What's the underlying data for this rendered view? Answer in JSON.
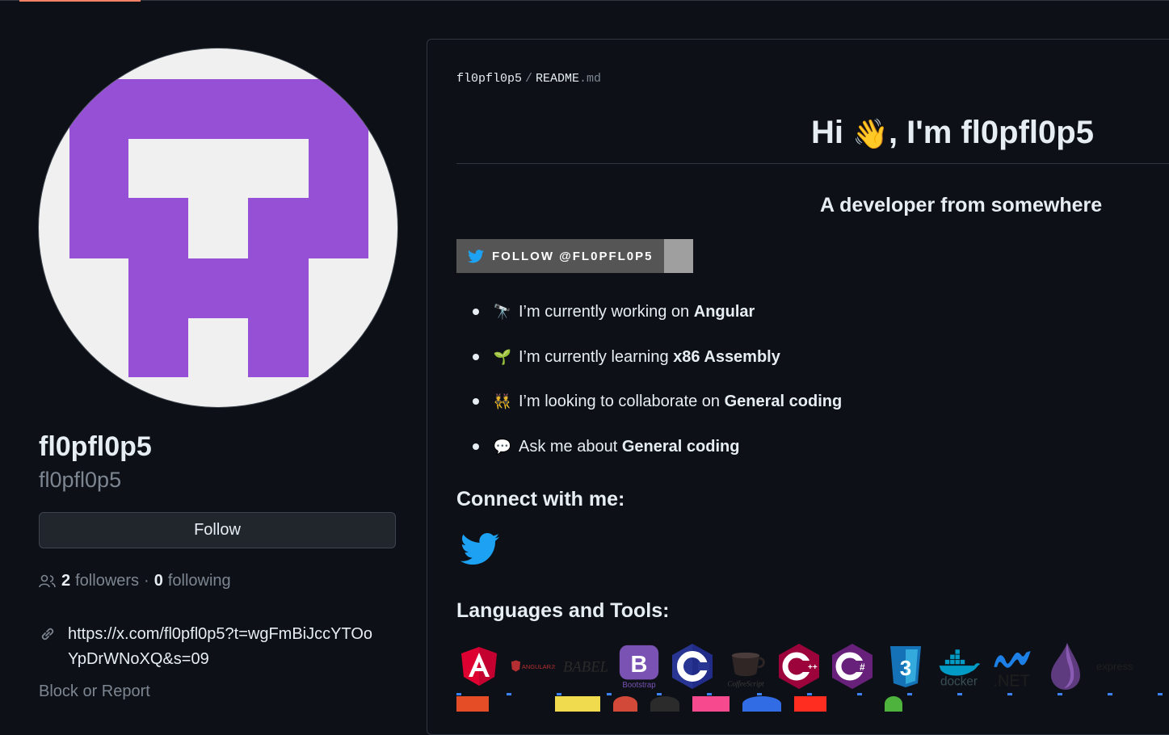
{
  "profile": {
    "display_name": "fl0pfl0p5",
    "login": "fl0pfl0p5",
    "follow_label": "Follow",
    "followers_count": "2",
    "followers_label": "followers",
    "separator": "·",
    "following_count": "0",
    "following_label": "following",
    "website": "https://x.com/fl0pfl0p5?t=wgFmBiJccYTOoYpDrWNoXQ&s=09",
    "block_label": "Block or Report",
    "avatar_color": "#9650d6"
  },
  "readme": {
    "path_user": "fl0pfl0p5",
    "path_sep": "/",
    "path_file": "README",
    "path_ext": ".md",
    "greeting_prefix": "Hi ",
    "greeting_emoji": "👋",
    "greeting_suffix": ", I'm fl0pfl0p5",
    "subtitle": "A developer from somewhere",
    "twitter_badge": "FOLLOW @FL0PFL0P5",
    "bullets": [
      {
        "emoji": "🔭",
        "text": "I’m currently working on ",
        "bold": "Angular"
      },
      {
        "emoji": "🌱",
        "text": "I’m currently learning ",
        "bold": "x86 Assembly"
      },
      {
        "emoji": "👯",
        "text": "I’m looking to collaborate on ",
        "bold": "General coding"
      },
      {
        "emoji": "💬",
        "text": "Ask me about ",
        "bold": "General coding"
      }
    ],
    "connect_heading": "Connect with me:",
    "languages_heading": "Languages and Tools:",
    "tools": [
      "angular-icon",
      "angularjs-icon",
      "babel-icon",
      "bootstrap-icon",
      "c-icon",
      "coffeescript-icon",
      "cplusplus-icon",
      "csharp-icon",
      "css3-icon",
      "docker-icon",
      "dotnet-icon",
      "elixir-icon",
      "express-icon"
    ],
    "tool_labels": {
      "angularjs": "ANGULARJS",
      "babel": "BABEL",
      "bootstrap": "Bootstrap",
      "coffeescript": "CoffeeScript",
      "docker": "docker",
      "dotnet": ".NET",
      "express": "express"
    }
  }
}
